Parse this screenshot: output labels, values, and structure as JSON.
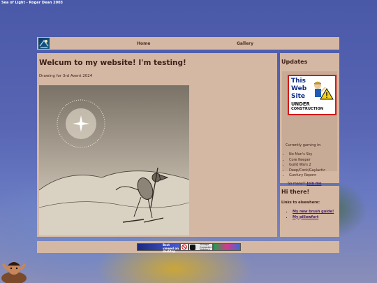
{
  "credit": "Sea of Light - Roger Dean 2003",
  "nav": {
    "home": "Home",
    "gallery": "Gallery"
  },
  "main": {
    "title": "Welcum to my website! I'm testing!",
    "caption": "Drawing for 3rd Avent 2024"
  },
  "updates": {
    "title": "Updates",
    "badge": {
      "line1": "This",
      "line2": "Web",
      "line3": "Site",
      "line4": "UNDER",
      "line5": "CONSTRUCTION"
    },
    "gaming_label": "Currently gaming in:",
    "games": [
      "No Man's Sky",
      "Core Keeper",
      "Guild Wars 2",
      "Deep/Cock/Gaylactic",
      "Gunfury Reporn"
    ],
    "tail_text": "So many!! ",
    "steam_link": "Join me through Steam!"
  },
  "hi": {
    "title": "Hi there!",
    "links_label": "Links to elsewhere:",
    "links": [
      "My new brush guide!",
      "My pillowfort"
    ]
  },
  "footer": {
    "button1": "Best viewed on desktop",
    "button3": "Vintage Computer Network"
  },
  "colors": {
    "panel": "#d4b8a3",
    "text": "#3c1f16",
    "link": "#4a1d6a",
    "badge_red": "#d21a1a",
    "badge_blue": "#0d2b86"
  }
}
